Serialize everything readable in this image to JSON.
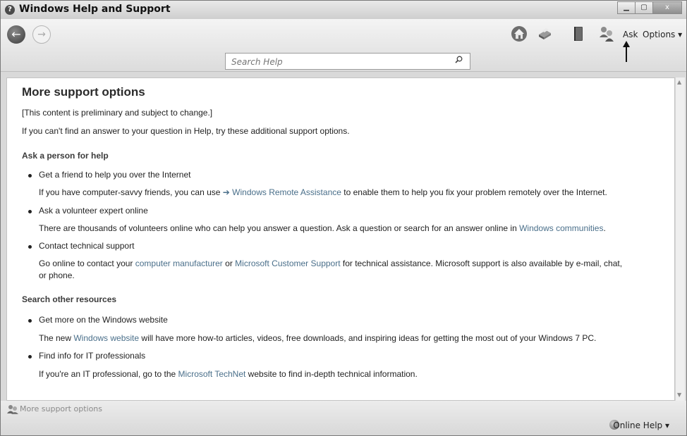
{
  "window": {
    "title": "Windows Help and Support",
    "controls": {
      "minimize": "▁",
      "maximize": "▢",
      "close": "x"
    }
  },
  "toolbar": {
    "search_placeholder": "Search Help",
    "ask_label": "Ask",
    "options_label": "Options ▾"
  },
  "content": {
    "title": "More support options",
    "preliminary_note": "[This content is preliminary and subject to change.]",
    "intro": "If you can't find an answer to your question in Help, try these additional support options.",
    "section1": {
      "heading": "Ask a person for help",
      "items": [
        {
          "label": "Get a friend to help you over the Internet",
          "desc_pre": "If you have computer-savvy friends, you can use ",
          "link": "➔ Windows Remote Assistance",
          "desc_post": " to enable them to help you fix your problem remotely over the Internet."
        },
        {
          "label": "Ask a volunteer expert online",
          "desc_pre": "There are thousands of volunteers online who can help you answer a question. Ask a question or search for an answer online in ",
          "link": "Windows communities",
          "desc_post": "."
        },
        {
          "label": "Contact technical support",
          "desc_pre": "Go online to contact your ",
          "link": "computer manufacturer",
          "desc_mid": " or ",
          "link2": "Microsoft Customer Support",
          "desc_post": " for technical assistance. Microsoft support is also available by e-mail, chat,",
          "desc_line2": "or phone."
        }
      ]
    },
    "section2": {
      "heading": "Search other resources",
      "items": [
        {
          "label": "Get more on the Windows website",
          "desc_pre": "The new ",
          "link": "Windows website",
          "desc_post": " will have more how-to articles, videos, free downloads, and inspiring ideas for getting the most out of your Windows 7 PC."
        },
        {
          "label": "Find info for IT professionals",
          "desc_pre": "If you're an IT professional, go to the ",
          "link": "Microsoft TechNet",
          "desc_post": " website to find in-depth technical information."
        }
      ]
    }
  },
  "status": {
    "page_label": "More support options",
    "online_help": "Online Help ▾"
  },
  "icons": {
    "help": "help-icon",
    "back": "back-arrow-icon",
    "forward": "forward-arrow-icon",
    "home": "home-icon",
    "print": "print-icon",
    "browse": "book-icon",
    "ask": "people-icon",
    "search": "search-icon",
    "online": "globe-icon"
  },
  "colors": {
    "link": "#4a6f8a"
  }
}
